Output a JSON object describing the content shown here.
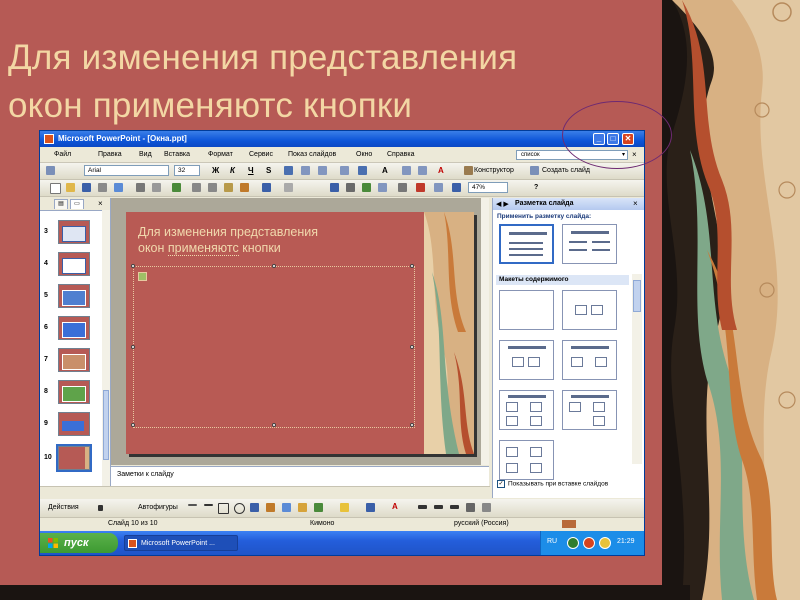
{
  "slide": {
    "title_line1": "Для изменения представления",
    "title_line2": "окон применяютс кнопки"
  },
  "window": {
    "title": "Microsoft PowerPoint - [Окна.ppt]",
    "buttons": {
      "minimize": "_",
      "maximize": "□",
      "close": "✕"
    }
  },
  "menu": {
    "items": [
      "Файл",
      "Правка",
      "Вид",
      "Вставка",
      "Формат",
      "Сервис",
      "Показ слайдов",
      "Окно",
      "Справка"
    ],
    "search_value": "список"
  },
  "toolbar": {
    "font_name": "Arial",
    "font_size": "32",
    "bold": "Ж",
    "italic": "К",
    "underline": "Ч",
    "shadow": "S",
    "zoom": "47%",
    "designer_label": "Конструктор",
    "new_slide_label": "Создать слайд",
    "help_icon": "?"
  },
  "thumbnails": {
    "numbers": [
      "3",
      "4",
      "5",
      "6",
      "7",
      "8",
      "9",
      "10"
    ],
    "selected": "10"
  },
  "editor": {
    "title_line1": "Для изменения представления",
    "title_line2_prefix": "окон ",
    "title_line2_underlined": "применяютс",
    "title_line2_suffix": " кнопки",
    "notes_placeholder": "Заметки к слайду"
  },
  "taskpane": {
    "title": "Разметка слайда",
    "apply_label": "Применить разметку слайда:",
    "section_label": "Макеты содержимого",
    "show_on_insert": "Показывать при вставке слайдов"
  },
  "drawing": {
    "actions_label": "Действия",
    "autoshapes_label": "Автофигуры"
  },
  "status": {
    "slide_info": "Слайд 10 из 10",
    "design": "Кимоно",
    "language": "русский (Россия)"
  },
  "taskbar": {
    "start_label": "пуск",
    "task_item": "Microsoft PowerPoint ...",
    "lang": "RU",
    "time": "21:29"
  },
  "colors": {
    "slide_background": "#b65a55",
    "title_text": "#f3d7a4",
    "xp_blue": "#0d55d8",
    "start_green": "#3d9a32",
    "callout_ellipse": "#6e2a72"
  }
}
